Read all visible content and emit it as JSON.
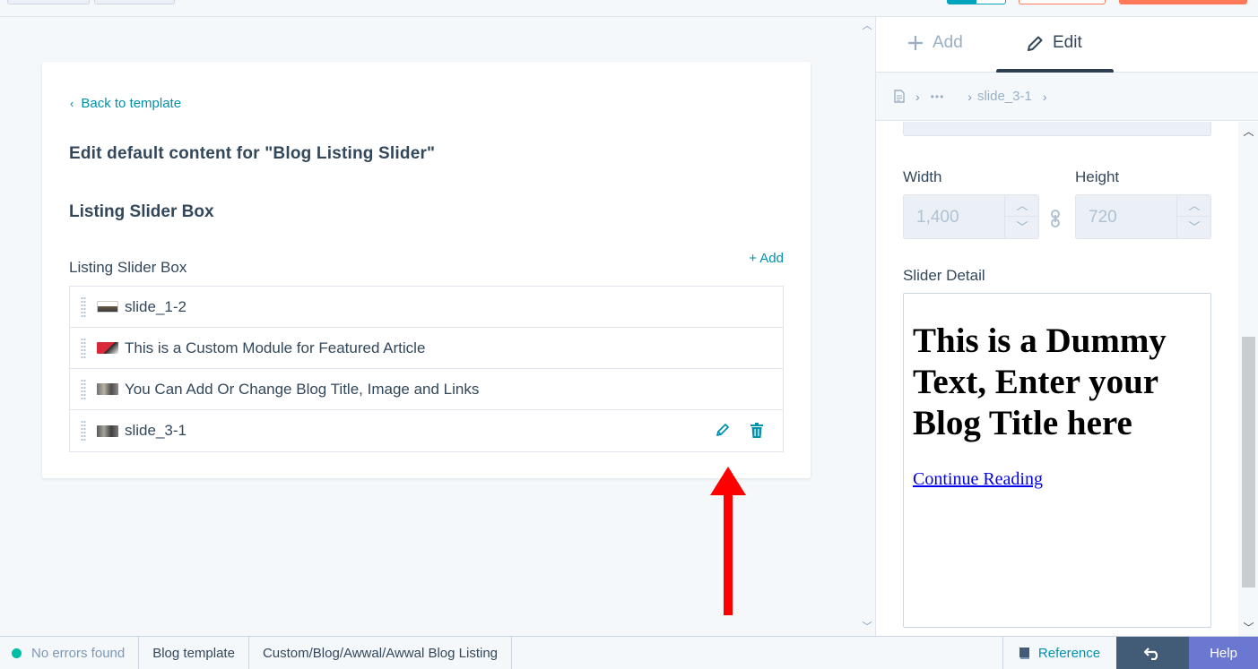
{
  "editor": {
    "back_link": "Back to template",
    "heading": "Edit default content for \"Blog Listing Slider\"",
    "section_heading": "Listing Slider Box",
    "field_label": "Listing Slider Box",
    "add_link": "+ Add",
    "slides": [
      {
        "label": "slide_1-2",
        "thumb": "image-thumbnail"
      },
      {
        "label": "This is a Custom Module for Featured Article",
        "thumb": "image-thumbnail"
      },
      {
        "label": "You Can Add Or Change Blog Title, Image and Links",
        "thumb": "image-thumbnail"
      },
      {
        "label": "slide_3-1",
        "thumb": "image-thumbnail"
      }
    ],
    "row_actions": {
      "edit_icon": "pencil-icon",
      "delete_icon": "trash-icon"
    }
  },
  "sidebar": {
    "tabs": {
      "add": "Add",
      "edit": "Edit"
    },
    "breadcrumb": {
      "ellipsis": "•••",
      "current": "slide_3-1"
    },
    "width": {
      "label": "Width",
      "value": "1,400"
    },
    "height": {
      "label": "Height",
      "value": "720"
    },
    "slider_detail": {
      "label": "Slider Detail",
      "heading": "This is a Dummy Text, Enter your Blog Title here",
      "link": "Continue Reading"
    }
  },
  "statusbar": {
    "status": "No errors found",
    "template_type": "Blog template",
    "path": "Custom/Blog/Awwal/Awwal Blog Listing",
    "reference": "Reference",
    "help": "Help"
  },
  "colors": {
    "accent": "#0091ae",
    "status_ok": "#00bda5",
    "annotation_arrow": "#ff0000",
    "help": "#6a78d1",
    "undo": "#425b76"
  }
}
